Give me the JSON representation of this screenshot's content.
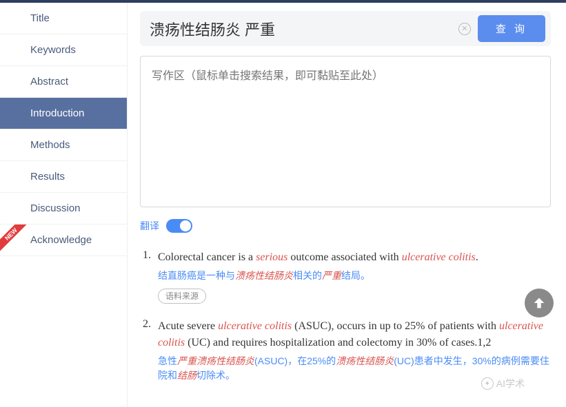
{
  "sidebar": {
    "items": [
      {
        "label": "Title"
      },
      {
        "label": "Keywords"
      },
      {
        "label": "Abstract"
      },
      {
        "label": "Introduction"
      },
      {
        "label": "Methods"
      },
      {
        "label": "Results"
      },
      {
        "label": "Discussion"
      },
      {
        "label": "Acknowledge"
      }
    ],
    "active_index": 3,
    "new_badge": "NEW"
  },
  "search": {
    "value": "溃疡性结肠炎 严重",
    "clear_symbol": "✕",
    "query_label": "查 询"
  },
  "write_area": {
    "placeholder": "写作区（鼠标单击搜索结果，即可黏贴至此处）"
  },
  "translate": {
    "label": "翻译",
    "on": true
  },
  "results": [
    {
      "num": "1.",
      "en_parts": [
        {
          "t": "Colorectal cancer is a ",
          "hl": false
        },
        {
          "t": "serious",
          "hl": true
        },
        {
          "t": " outcome associated with ",
          "hl": false
        },
        {
          "t": "ulcerative colitis",
          "hl": true
        },
        {
          "t": ".",
          "hl": false
        }
      ],
      "zh_parts": [
        {
          "t": "结直肠癌是一种与",
          "hl": false
        },
        {
          "t": "溃疡性结肠炎",
          "hl": true
        },
        {
          "t": "相关的",
          "hl": false
        },
        {
          "t": "严重",
          "hl": true
        },
        {
          "t": "结局。",
          "hl": false
        }
      ],
      "source_label": "语料来源"
    },
    {
      "num": "2.",
      "en_parts": [
        {
          "t": "Acute severe ",
          "hl": false
        },
        {
          "t": "ulcerative colitis",
          "hl": true
        },
        {
          "t": " (ASUC), occurs in up to 25% of patients with ",
          "hl": false
        },
        {
          "t": "ulcerative colitis",
          "hl": true
        },
        {
          "t": " (UC) and requires hospitalization and colectomy in 30% of cases.1,2",
          "hl": false
        }
      ],
      "zh_parts": [
        {
          "t": "急性",
          "hl": false
        },
        {
          "t": "严重溃疡性结肠炎",
          "hl": true
        },
        {
          "t": "(ASUC)，在25%的",
          "hl": false
        },
        {
          "t": "溃疡性结肠炎",
          "hl": true
        },
        {
          "t": "(UC)患者中发生，30%的病例需要住院和",
          "hl": false
        },
        {
          "t": "结肠",
          "hl": true
        },
        {
          "t": "切除术。",
          "hl": false
        }
      ]
    }
  ],
  "watermark": "AI学术"
}
